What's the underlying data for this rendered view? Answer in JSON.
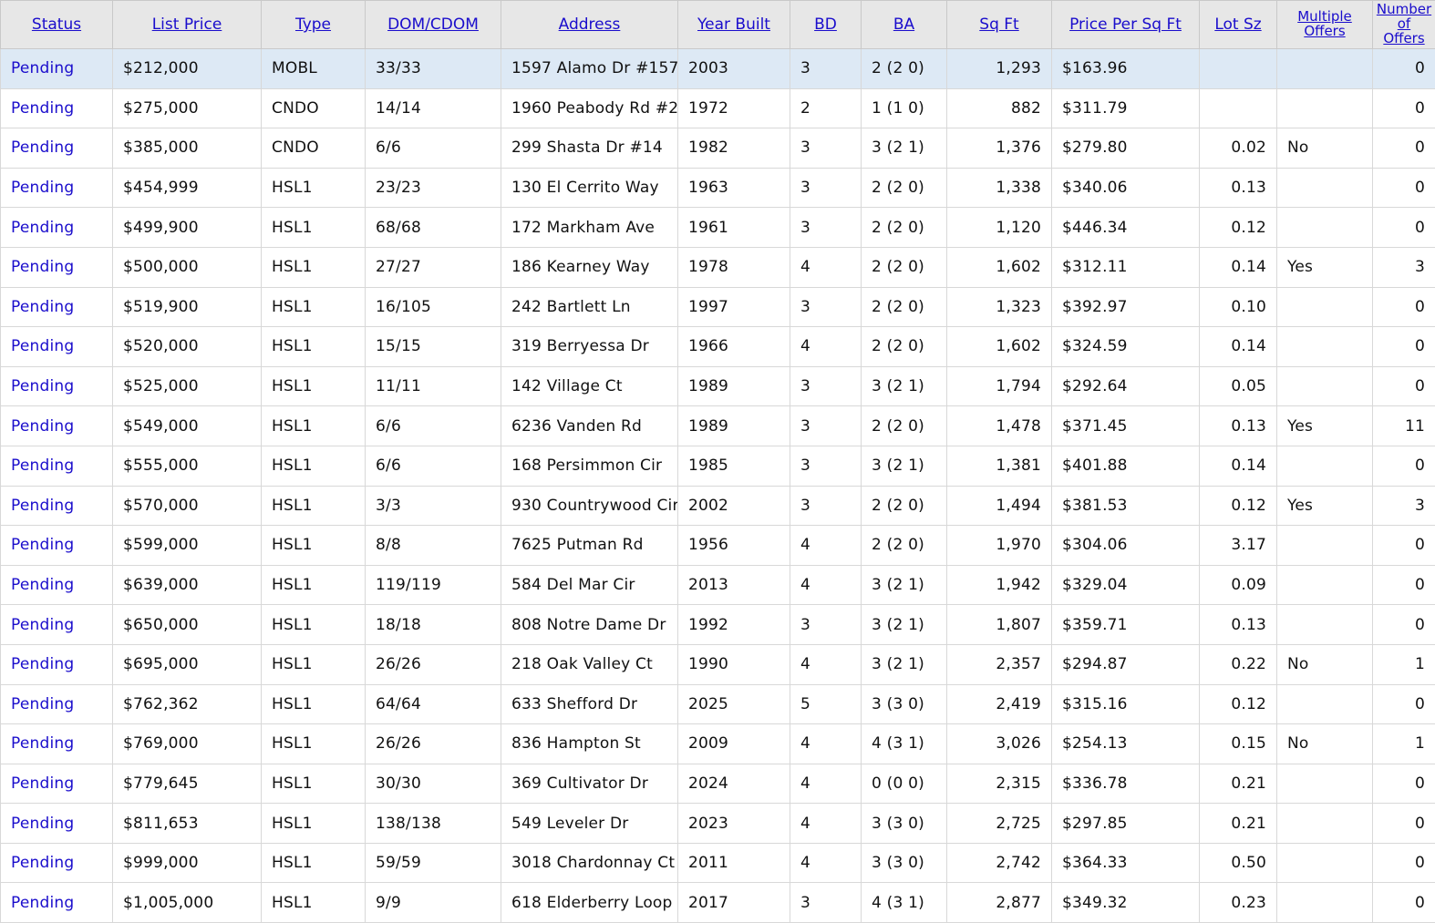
{
  "columns": {
    "status": "Status",
    "list_price": "List Price",
    "type": "Type",
    "dom_cdom": "DOM/CDOM",
    "address": "Address",
    "year_built": "Year Built",
    "bd": "BD",
    "ba": "BA",
    "sq_ft": "Sq Ft",
    "price_per_sq_ft": "Price Per Sq Ft",
    "lot_sz": "Lot Sz",
    "multiple_offers_1": "Multiple",
    "multiple_offers_2": "Offers",
    "num_offers_1": "Number",
    "num_offers_2": "of",
    "num_offers_3": "Offers"
  },
  "rows": [
    {
      "status": "Pending",
      "price": "$212,000",
      "type": "MOBL",
      "dom": "33/33",
      "address": "1597 Alamo Dr #157",
      "year": "2003",
      "bd": "3",
      "ba": "2 (2 0)",
      "sqft": "1,293",
      "ppsf": "$163.96",
      "lot": "",
      "multi": "",
      "offers": "0"
    },
    {
      "status": "Pending",
      "price": "$275,000",
      "type": "CNDO",
      "dom": "14/14",
      "address": "1960 Peabody Rd #2",
      "year": "1972",
      "bd": "2",
      "ba": "1 (1 0)",
      "sqft": "882",
      "ppsf": "$311.79",
      "lot": "",
      "multi": "",
      "offers": "0"
    },
    {
      "status": "Pending",
      "price": "$385,000",
      "type": "CNDO",
      "dom": "6/6",
      "address": "299 Shasta Dr #14",
      "year": "1982",
      "bd": "3",
      "ba": "3 (2 1)",
      "sqft": "1,376",
      "ppsf": "$279.80",
      "lot": "0.02",
      "multi": "No",
      "offers": "0"
    },
    {
      "status": "Pending",
      "price": "$454,999",
      "type": "HSL1",
      "dom": "23/23",
      "address": "130 El Cerrito Way",
      "year": "1963",
      "bd": "3",
      "ba": "2 (2 0)",
      "sqft": "1,338",
      "ppsf": "$340.06",
      "lot": "0.13",
      "multi": "",
      "offers": "0"
    },
    {
      "status": "Pending",
      "price": "$499,900",
      "type": "HSL1",
      "dom": "68/68",
      "address": "172 Markham Ave",
      "year": "1961",
      "bd": "3",
      "ba": "2 (2 0)",
      "sqft": "1,120",
      "ppsf": "$446.34",
      "lot": "0.12",
      "multi": "",
      "offers": "0"
    },
    {
      "status": "Pending",
      "price": "$500,000",
      "type": "HSL1",
      "dom": "27/27",
      "address": "186 Kearney Way",
      "year": "1978",
      "bd": "4",
      "ba": "2 (2 0)",
      "sqft": "1,602",
      "ppsf": "$312.11",
      "lot": "0.14",
      "multi": "Yes",
      "offers": "3"
    },
    {
      "status": "Pending",
      "price": "$519,900",
      "type": "HSL1",
      "dom": "16/105",
      "address": "242 Bartlett Ln",
      "year": "1997",
      "bd": "3",
      "ba": "2 (2 0)",
      "sqft": "1,323",
      "ppsf": "$392.97",
      "lot": "0.10",
      "multi": "",
      "offers": "0"
    },
    {
      "status": "Pending",
      "price": "$520,000",
      "type": "HSL1",
      "dom": "15/15",
      "address": "319 Berryessa Dr",
      "year": "1966",
      "bd": "4",
      "ba": "2 (2 0)",
      "sqft": "1,602",
      "ppsf": "$324.59",
      "lot": "0.14",
      "multi": "",
      "offers": "0"
    },
    {
      "status": "Pending",
      "price": "$525,000",
      "type": "HSL1",
      "dom": "11/11",
      "address": "142 Village Ct",
      "year": "1989",
      "bd": "3",
      "ba": "3 (2 1)",
      "sqft": "1,794",
      "ppsf": "$292.64",
      "lot": "0.05",
      "multi": "",
      "offers": "0"
    },
    {
      "status": "Pending",
      "price": "$549,000",
      "type": "HSL1",
      "dom": "6/6",
      "address": "6236 Vanden Rd",
      "year": "1989",
      "bd": "3",
      "ba": "2 (2 0)",
      "sqft": "1,478",
      "ppsf": "$371.45",
      "lot": "0.13",
      "multi": "Yes",
      "offers": "11"
    },
    {
      "status": "Pending",
      "price": "$555,000",
      "type": "HSL1",
      "dom": "6/6",
      "address": "168 Persimmon Cir",
      "year": "1985",
      "bd": "3",
      "ba": "3 (2 1)",
      "sqft": "1,381",
      "ppsf": "$401.88",
      "lot": "0.14",
      "multi": "",
      "offers": "0"
    },
    {
      "status": "Pending",
      "price": "$570,000",
      "type": "HSL1",
      "dom": "3/3",
      "address": "930 Countrywood Cir",
      "year": "2002",
      "bd": "3",
      "ba": "2 (2 0)",
      "sqft": "1,494",
      "ppsf": "$381.53",
      "lot": "0.12",
      "multi": "Yes",
      "offers": "3"
    },
    {
      "status": "Pending",
      "price": "$599,000",
      "type": "HSL1",
      "dom": "8/8",
      "address": "7625 Putman Rd",
      "year": "1956",
      "bd": "4",
      "ba": "2 (2 0)",
      "sqft": "1,970",
      "ppsf": "$304.06",
      "lot": "3.17",
      "multi": "",
      "offers": "0"
    },
    {
      "status": "Pending",
      "price": "$639,000",
      "type": "HSL1",
      "dom": "119/119",
      "address": "584 Del Mar Cir",
      "year": "2013",
      "bd": "4",
      "ba": "3 (2 1)",
      "sqft": "1,942",
      "ppsf": "$329.04",
      "lot": "0.09",
      "multi": "",
      "offers": "0"
    },
    {
      "status": "Pending",
      "price": "$650,000",
      "type": "HSL1",
      "dom": "18/18",
      "address": "808 Notre Dame Dr",
      "year": "1992",
      "bd": "3",
      "ba": "3 (2 1)",
      "sqft": "1,807",
      "ppsf": "$359.71",
      "lot": "0.13",
      "multi": "",
      "offers": "0"
    },
    {
      "status": "Pending",
      "price": "$695,000",
      "type": "HSL1",
      "dom": "26/26",
      "address": "218 Oak Valley Ct",
      "year": "1990",
      "bd": "4",
      "ba": "3 (2 1)",
      "sqft": "2,357",
      "ppsf": "$294.87",
      "lot": "0.22",
      "multi": "No",
      "offers": "1"
    },
    {
      "status": "Pending",
      "price": "$762,362",
      "type": "HSL1",
      "dom": "64/64",
      "address": "633 Shefford Dr",
      "year": "2025",
      "bd": "5",
      "ba": "3 (3 0)",
      "sqft": "2,419",
      "ppsf": "$315.16",
      "lot": "0.12",
      "multi": "",
      "offers": "0"
    },
    {
      "status": "Pending",
      "price": "$769,000",
      "type": "HSL1",
      "dom": "26/26",
      "address": "836 Hampton St",
      "year": "2009",
      "bd": "4",
      "ba": "4 (3 1)",
      "sqft": "3,026",
      "ppsf": "$254.13",
      "lot": "0.15",
      "multi": "No",
      "offers": "1"
    },
    {
      "status": "Pending",
      "price": "$779,645",
      "type": "HSL1",
      "dom": "30/30",
      "address": "369 Cultivator Dr",
      "year": "2024",
      "bd": "4",
      "ba": "0 (0 0)",
      "sqft": "2,315",
      "ppsf": "$336.78",
      "lot": "0.21",
      "multi": "",
      "offers": "0"
    },
    {
      "status": "Pending",
      "price": "$811,653",
      "type": "HSL1",
      "dom": "138/138",
      "address": "549 Leveler Dr",
      "year": "2023",
      "bd": "4",
      "ba": "3 (3 0)",
      "sqft": "2,725",
      "ppsf": "$297.85",
      "lot": "0.21",
      "multi": "",
      "offers": "0"
    },
    {
      "status": "Pending",
      "price": "$999,000",
      "type": "HSL1",
      "dom": "59/59",
      "address": "3018 Chardonnay Ct",
      "year": "2011",
      "bd": "4",
      "ba": "3 (3 0)",
      "sqft": "2,742",
      "ppsf": "$364.33",
      "lot": "0.50",
      "multi": "",
      "offers": "0"
    },
    {
      "status": "Pending",
      "price": "$1,005,000",
      "type": "HSL1",
      "dom": "9/9",
      "address": "618 Elderberry Loop",
      "year": "2017",
      "bd": "3",
      "ba": "4 (3 1)",
      "sqft": "2,877",
      "ppsf": "$349.32",
      "lot": "0.23",
      "multi": "",
      "offers": "0"
    }
  ]
}
